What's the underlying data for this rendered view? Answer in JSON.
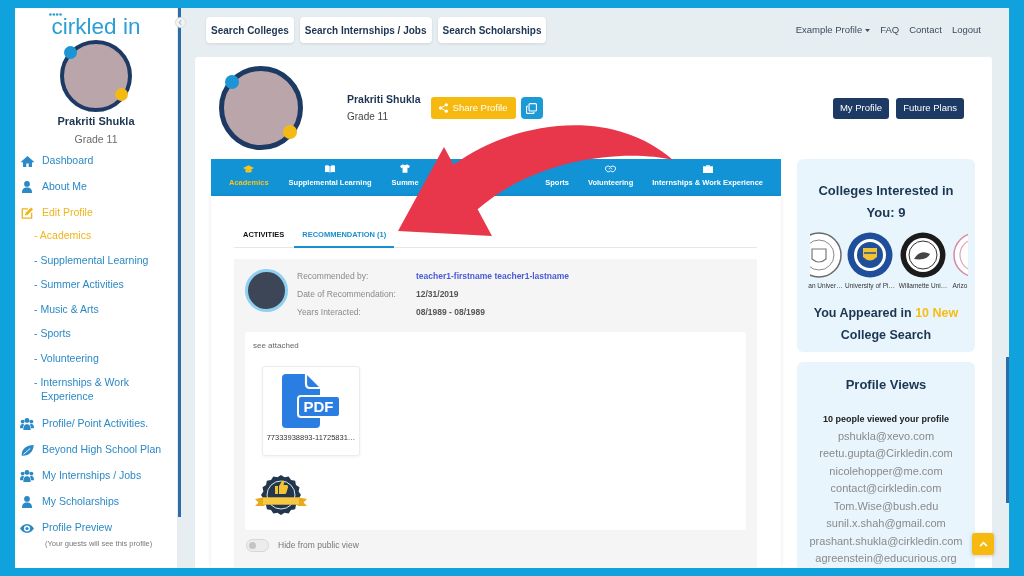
{
  "sidebar": {
    "logo": "cirkled in",
    "profile": {
      "name": "Prakriti Shukla",
      "grade": "Grade 11"
    },
    "items": [
      {
        "label": "Dashboard",
        "selected": false
      },
      {
        "label": "About Me",
        "selected": false
      },
      {
        "label": "Edit Profile",
        "selected": true,
        "children": [
          {
            "label": "- Academics",
            "selected": true
          },
          {
            "label": "- Supplemental Learning",
            "selected": false
          },
          {
            "label": "- Summer Activities",
            "selected": false
          },
          {
            "label": "- Music & Arts",
            "selected": false
          },
          {
            "label": "- Sports",
            "selected": false
          },
          {
            "label": "- Volunteering",
            "selected": false
          },
          {
            "label": "- Internships & Work Experience",
            "selected": false
          }
        ]
      },
      {
        "label": "Profile/ Point Activities.",
        "selected": false
      },
      {
        "label": "Beyond High School Plan",
        "selected": false
      },
      {
        "label": "My Internships / Jobs",
        "selected": false
      },
      {
        "label": "My Scholarships",
        "selected": false
      },
      {
        "label": "Profile Preview",
        "selected": false,
        "note": "(Your guests will see this profile)"
      }
    ]
  },
  "top_bar": {
    "buttons": [
      "Search Colleges",
      "Search Internships / Jobs",
      "Search Scholarships"
    ],
    "links": [
      {
        "label": "Example Profile",
        "dropdown": true
      },
      {
        "label": "FAQ",
        "dropdown": false
      },
      {
        "label": "Contact",
        "dropdown": false
      },
      {
        "label": "Logout",
        "dropdown": false
      }
    ]
  },
  "profile_header": {
    "name": "Prakriti Shukla",
    "grade": "Grade 11",
    "share_button": "Share Profile",
    "buttons": [
      "My Profile",
      "Future Plans"
    ]
  },
  "section_tabs": [
    {
      "label": "Academics",
      "selected": true
    },
    {
      "label": "Supplemental Learning",
      "selected": false
    },
    {
      "label": "Summe",
      "selected": false
    },
    {
      "label": "Sports",
      "selected": false
    },
    {
      "label": "Volunteering",
      "selected": false
    },
    {
      "label": "Internships & Work Experience",
      "selected": false
    }
  ],
  "sub_tabs": [
    {
      "label": "ACTIVITIES",
      "selected": false
    },
    {
      "label": "RECOMMENDATION (1)",
      "selected": true
    }
  ],
  "recommendation": {
    "fields": [
      {
        "label": "Recommended by:",
        "value": "teacher1-firstname teacher1-lastname",
        "kind": "link"
      },
      {
        "label": "Date of Recommendation:",
        "value": "12/31/2019",
        "kind": "text"
      },
      {
        "label": "Years Interacted:",
        "value": "08/1989 - 08/1989",
        "kind": "text"
      }
    ],
    "message": "see attached",
    "attachments": [
      {
        "file_type": "PDF",
        "file_name": "77333938893-11725831…"
      }
    ],
    "hide_toggle": {
      "label": "Hide from public view",
      "on": false
    }
  },
  "colleges_panel": {
    "title": "Colleges Interested in You: 9",
    "colleges": [
      {
        "name": "an Univer…"
      },
      {
        "name": "University of Pi…"
      },
      {
        "name": "Willamette Uni…"
      },
      {
        "name": "Arizo"
      }
    ],
    "appeared": {
      "before": "You Appeared in",
      "highlight": "10 New",
      "after": "College Search"
    }
  },
  "profile_views": {
    "title": "Profile Views",
    "summary": "10 people viewed your profile",
    "viewers": [
      "pshukla@xevo.com",
      "reetu.gupta@Cirkledin.com",
      "nicolehopper@me.com",
      "contact@cirkledin.com",
      "Tom.Wise@bush.edu",
      "sunil.x.shah@gmail.com",
      "prashant.shukla@cirkledin.com",
      "agreenstein@educurious.org"
    ]
  }
}
